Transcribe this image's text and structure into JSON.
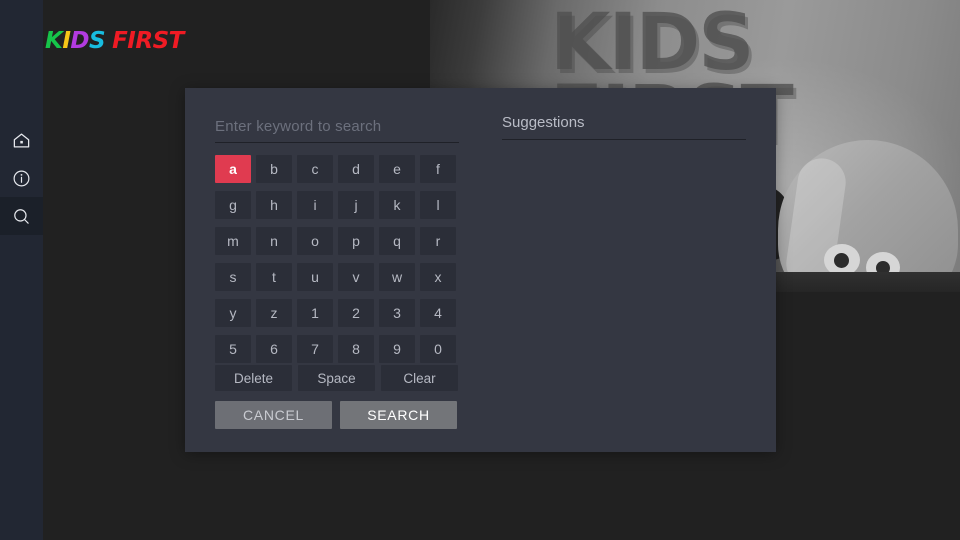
{
  "app": {
    "background_color": "#212121",
    "sidebar_color": "#222733",
    "accent_color": "#e03b50"
  },
  "brand": {
    "letters": [
      {
        "char": "K",
        "color": "#16c44a"
      },
      {
        "char": "I",
        "color": "#f5c518"
      },
      {
        "char": "D",
        "color": "#b23be0"
      },
      {
        "char": "S",
        "color": "#18bde0"
      },
      {
        "char": "F",
        "color": "#ef1b24"
      },
      {
        "char": "I",
        "color": "#ef1b24"
      },
      {
        "char": "R",
        "color": "#ef1b24"
      },
      {
        "char": "S",
        "color": "#ef1b24"
      },
      {
        "char": "T",
        "color": "#ef1b24"
      }
    ],
    "text": "KIDS FIRST"
  },
  "sidebar": {
    "items": [
      {
        "name": "home",
        "icon": "home-icon",
        "active": false
      },
      {
        "name": "info",
        "icon": "info-icon",
        "active": false
      },
      {
        "name": "search",
        "icon": "search-icon",
        "active": true
      }
    ]
  },
  "hero": {
    "title": "KIDS\nFIRST"
  },
  "dialog": {
    "search": {
      "value": "",
      "placeholder": "Enter keyword to search"
    },
    "suggestions": {
      "title": "Suggestions",
      "items": []
    },
    "keyboard": {
      "keys": [
        "a",
        "b",
        "c",
        "d",
        "e",
        "f",
        "g",
        "h",
        "i",
        "j",
        "k",
        "l",
        "m",
        "n",
        "o",
        "p",
        "q",
        "r",
        "s",
        "t",
        "u",
        "v",
        "w",
        "x",
        "y",
        "z",
        "1",
        "2",
        "3",
        "4",
        "5",
        "6",
        "7",
        "8",
        "9",
        "0"
      ],
      "selected_key": "a"
    },
    "actions": [
      {
        "label": "Delete",
        "name": "delete"
      },
      {
        "label": "Space",
        "name": "space"
      },
      {
        "label": "Clear",
        "name": "clear"
      }
    ],
    "buttons": {
      "cancel_label": "CANCEL",
      "search_label": "SEARCH"
    }
  }
}
